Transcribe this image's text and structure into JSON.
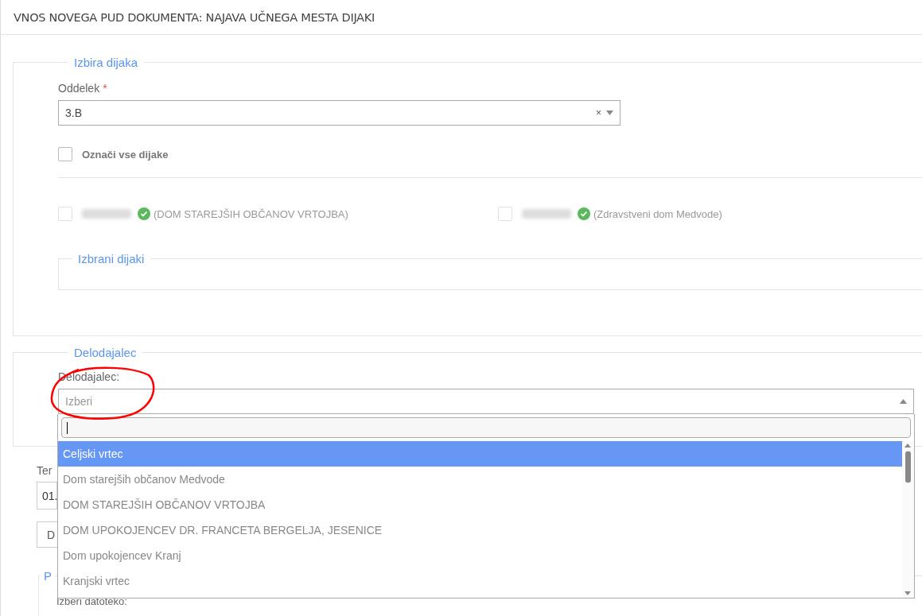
{
  "title": "VNOS NOVEGA PUD DOKUMENTA: NAJAVA UČNEGA MESTA DIJAKI",
  "student_section": {
    "legend": "Izbira dijaka",
    "class_label": "Oddelek",
    "required_mark": "*",
    "class_value": "3.B",
    "clear_symbol": "×",
    "select_all": {
      "label": "Označi vse dijake",
      "checked": false
    },
    "students": [
      {
        "workplace": "(DOM STAREJŠIH OBČANOV VRTOJBA)",
        "checked": false,
        "disabled": true
      },
      {
        "workplace": "(Zdravstveni dom Medvode)",
        "checked": false,
        "disabled": true
      }
    ],
    "selected_legend": "Izbrani dijaki"
  },
  "employer_section": {
    "legend": "Delodajalec",
    "label": "Delodajalec:",
    "placeholder": "Izberi",
    "expanded": true,
    "options": [
      {
        "label": "Celjski vrtec",
        "selected": true
      },
      {
        "label": "Dom starejših občanov Medvode",
        "selected": false
      },
      {
        "label": "DOM STAREJŠIH OBČANOV VRTOJBA",
        "selected": false
      },
      {
        "label": "DOM UPOKOJENCEV DR. FRANCETA BERGELJA, JESENICE",
        "selected": false
      },
      {
        "label": "Dom upokojencev Kranj",
        "selected": false
      },
      {
        "label": "Kranjski vrtec",
        "selected": false
      }
    ]
  },
  "below": {
    "term_label": "Ter",
    "date_value": "01.",
    "button_label": "D",
    "legend": "P",
    "file_label": "Izberi datoteko:"
  }
}
